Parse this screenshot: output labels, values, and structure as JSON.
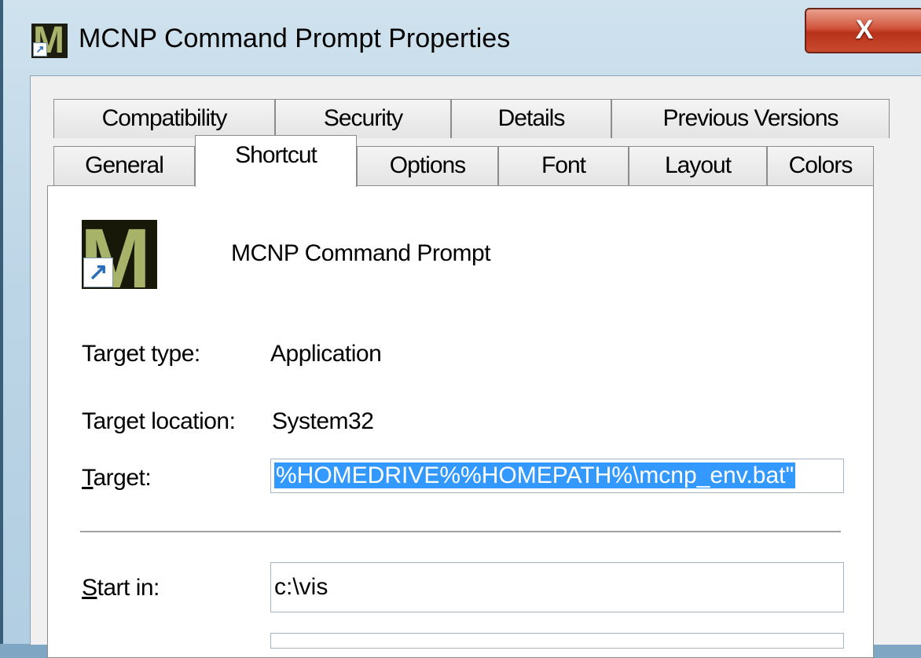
{
  "window": {
    "title": "MCNP Command Prompt Properties",
    "close_glyph": "X",
    "accent_color": "#c84a2e"
  },
  "tabs": {
    "row_top": [
      "Compatibility",
      "Security",
      "Details",
      "Previous Versions"
    ],
    "row_bottom": [
      "General",
      "Shortcut",
      "Options",
      "Font",
      "Layout",
      "Colors"
    ],
    "active": "Shortcut"
  },
  "shortcut": {
    "name": "MCNP Command Prompt",
    "target_type_label": "Target type:",
    "target_type_value": "Application",
    "target_location_label": "Target location:",
    "target_location_value": "System32",
    "target_label_accel": "T",
    "target_label_rest": "arget:",
    "target_value": "%HOMEDRIVE%%HOMEPATH%\\mcnp_env.bat\"",
    "start_in_label_accel": "S",
    "start_in_label_rest": "tart in:",
    "start_in_value": "c:\\vis",
    "selection_color": "#3399ff"
  },
  "icons": [
    "mcnp-app-icon",
    "shortcut-arrow-icon",
    "close-icon"
  ]
}
